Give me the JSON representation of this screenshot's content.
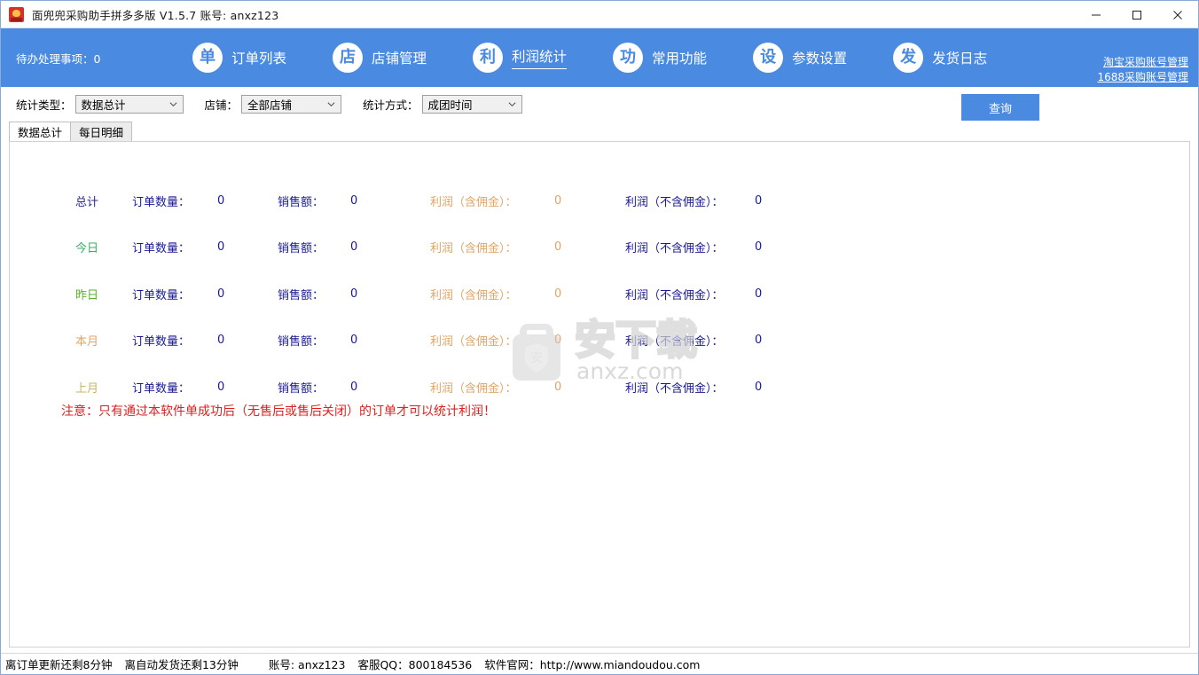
{
  "window": {
    "title": "面兜兜采购助手拼多多版 V1.5.7   账号: anxz123",
    "app_icon": "app-logo-icon",
    "minimize": "minimize-icon",
    "maximize": "maximize-icon",
    "close": "close-icon"
  },
  "nav": {
    "todo_text": "待办处理事项：0",
    "accent_color": "#4a8ae0",
    "items": [
      {
        "badge": "单",
        "label": "订单列表",
        "active": false
      },
      {
        "badge": "店",
        "label": "店铺管理",
        "active": false
      },
      {
        "badge": "利",
        "label": "利润统计",
        "active": true
      },
      {
        "badge": "功",
        "label": "常用功能",
        "active": false
      },
      {
        "badge": "设",
        "label": "参数设置",
        "active": false
      },
      {
        "badge": "发",
        "label": "发货日志",
        "active": false
      }
    ],
    "links": [
      "淘宝采购账号管理",
      "1688采购账号管理"
    ]
  },
  "filters": {
    "stat_type": {
      "label": "统计类型：",
      "value": "数据总计"
    },
    "shop": {
      "label": "店铺：",
      "value": "全部店铺"
    },
    "stat_mode": {
      "label": "统计方式：",
      "value": "成团时间"
    },
    "query_button": "查询"
  },
  "tabs": [
    {
      "label": "数据总计",
      "active": true
    },
    {
      "label": "每日明细",
      "active": false
    }
  ],
  "table": {
    "labels": {
      "orders": "订单数量：",
      "sales": "销售额：",
      "profit_incl": "利润（含佣金）：",
      "profit_excl": "利润（不含佣金）："
    },
    "rows": [
      {
        "period": "总计",
        "period_color": "#2a2a8c",
        "orders": "0",
        "sales": "0",
        "profit_incl": "0",
        "profit_excl": "0"
      },
      {
        "period": "今日",
        "period_color": "#35b063",
        "orders": "0",
        "sales": "0",
        "profit_incl": "0",
        "profit_excl": "0"
      },
      {
        "period": "昨日",
        "period_color": "#5ab02e",
        "orders": "0",
        "sales": "0",
        "profit_incl": "0",
        "profit_excl": "0"
      },
      {
        "period": "本月",
        "period_color": "#e0a667",
        "orders": "0",
        "sales": "0",
        "profit_incl": "0",
        "profit_excl": "0"
      },
      {
        "period": "上月",
        "period_color": "#c8b56a",
        "orders": "0",
        "sales": "0",
        "profit_incl": "0",
        "profit_excl": "0"
      }
    ],
    "notice": "注意：只有通过本软件单成功后（无售后或售后关闭）的订单才可以统计利润！",
    "notice_color": "#e02020"
  },
  "watermark": {
    "glyph": "安",
    "text": "安下载",
    "site": "anxz.com"
  },
  "status": {
    "order_update": "离订单更新还剩8分钟",
    "auto_ship": "离自动发货还剩13分钟",
    "account": "账号: anxz123",
    "qq": "客服QQ：800184536",
    "website": "软件官网：http://www.miandoudou.com"
  }
}
